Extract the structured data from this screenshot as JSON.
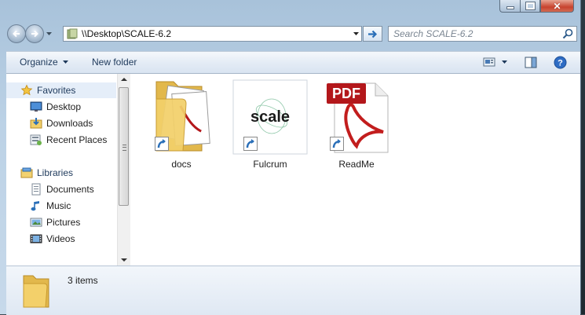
{
  "window": {
    "caption_close": "✕"
  },
  "address_bar": {
    "path": "\\\\Desktop\\SCALE-6.2"
  },
  "search": {
    "placeholder": "Search SCALE-6.2"
  },
  "toolbar": {
    "organize_label": "Organize",
    "new_folder_label": "New folder"
  },
  "nav_pane": {
    "favorites_label": "Favorites",
    "favorites": [
      {
        "label": "Desktop",
        "icon": "desktop-icon"
      },
      {
        "label": "Downloads",
        "icon": "downloads-icon"
      },
      {
        "label": "Recent Places",
        "icon": "recent-places-icon"
      }
    ],
    "libraries_label": "Libraries",
    "libraries": [
      {
        "label": "Documents",
        "icon": "documents-icon"
      },
      {
        "label": "Music",
        "icon": "music-icon"
      },
      {
        "label": "Pictures",
        "icon": "pictures-icon"
      },
      {
        "label": "Videos",
        "icon": "videos-icon"
      }
    ]
  },
  "files": [
    {
      "name": "docs",
      "icon": "folder-shortcut-icon"
    },
    {
      "name": "Fulcrum",
      "icon": "scale-app-shortcut-icon",
      "logo_text": "scale"
    },
    {
      "name": "ReadMe",
      "icon": "pdf-shortcut-icon",
      "badge_text": "PDF"
    }
  ],
  "details": {
    "item_count": "3 items"
  },
  "colors": {
    "frame": "#bcd2e6",
    "selected_nav": "#e5eef9",
    "pdf_red": "#b3171b",
    "folder_yellow": "#f3d06a"
  }
}
